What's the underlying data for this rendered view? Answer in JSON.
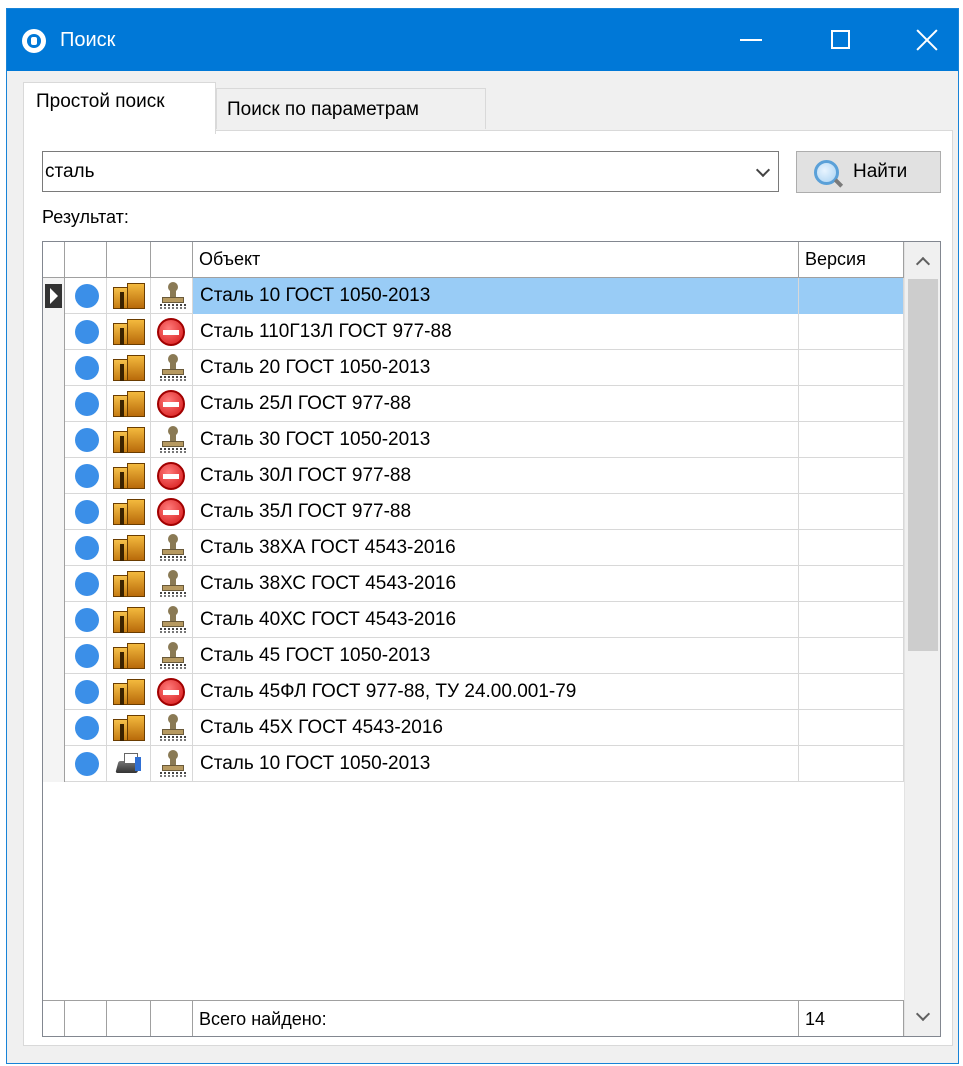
{
  "window": {
    "title": "Поиск",
    "accent": "#0078d7"
  },
  "tabs": [
    {
      "label": "Простой поиск",
      "active": true
    },
    {
      "label": "Поиск по параметрам",
      "active": false
    }
  ],
  "search": {
    "value": "сталь",
    "button_label": "Найти",
    "button_icon": "magnifier-icon"
  },
  "results": {
    "label": "Результат:",
    "columns": {
      "object": "Объект",
      "version": "Версия"
    },
    "rows": [
      {
        "object": "Сталь 10 ГОСТ 1050-2013",
        "version": "",
        "type_icon": "box-icon",
        "state_icon": "stamp-icon",
        "selected": true
      },
      {
        "object": "Сталь 110Г13Л ГОСТ 977-88",
        "version": "",
        "type_icon": "box-icon",
        "state_icon": "stop-icon"
      },
      {
        "object": "Сталь 20 ГОСТ 1050-2013",
        "version": "",
        "type_icon": "box-icon",
        "state_icon": "stamp-icon"
      },
      {
        "object": "Сталь 25Л ГОСТ 977-88",
        "version": "",
        "type_icon": "box-icon",
        "state_icon": "stop-icon"
      },
      {
        "object": "Сталь 30 ГОСТ 1050-2013",
        "version": "",
        "type_icon": "box-icon",
        "state_icon": "stamp-icon"
      },
      {
        "object": "Сталь 30Л ГОСТ 977-88",
        "version": "",
        "type_icon": "box-icon",
        "state_icon": "stop-icon"
      },
      {
        "object": "Сталь 35Л ГОСТ 977-88",
        "version": "",
        "type_icon": "box-icon",
        "state_icon": "stop-icon"
      },
      {
        "object": "Сталь 38ХА ГОСТ 4543-2016",
        "version": "",
        "type_icon": "box-icon",
        "state_icon": "stamp-icon"
      },
      {
        "object": "Сталь 38ХС ГОСТ 4543-2016",
        "version": "",
        "type_icon": "box-icon",
        "state_icon": "stamp-icon"
      },
      {
        "object": "Сталь 40ХС ГОСТ 4543-2016",
        "version": "",
        "type_icon": "box-icon",
        "state_icon": "stamp-icon"
      },
      {
        "object": "Сталь 45 ГОСТ 1050-2013",
        "version": "",
        "type_icon": "box-icon",
        "state_icon": "stamp-icon"
      },
      {
        "object": "Сталь 45ФЛ ГОСТ 977-88, ТУ 24.00.001-79",
        "version": "",
        "type_icon": "box-icon",
        "state_icon": "stop-icon"
      },
      {
        "object": "Сталь 45Х ГОСТ 4543-2016",
        "version": "",
        "type_icon": "box-icon",
        "state_icon": "stamp-icon"
      },
      {
        "object": "Сталь 10 ГОСТ 1050-2013",
        "version": "",
        "type_icon": "printer-icon",
        "state_icon": "stamp-icon"
      }
    ],
    "footer": {
      "label": "Всего найдено:",
      "count": "14"
    }
  }
}
